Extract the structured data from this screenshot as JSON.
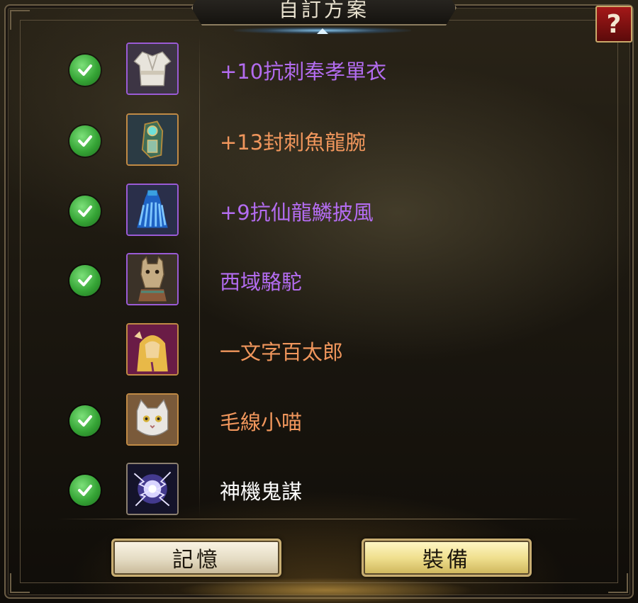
{
  "dialog": {
    "title": "自訂方案",
    "help_label": "?"
  },
  "items": [
    {
      "name": "+10抗刺奉孝單衣",
      "checked": true,
      "name_color": "#b36cf0",
      "icon": "white-robe-icon",
      "rarity": "purple"
    },
    {
      "name": "+13封刺魚龍腕",
      "checked": true,
      "name_color": "#f0965c",
      "icon": "jade-bracer-icon",
      "rarity": "gold"
    },
    {
      "name": "+9抗仙龍鱗披風",
      "checked": true,
      "name_color": "#b36cf0",
      "icon": "blue-feather-cloak-icon",
      "rarity": "purple"
    },
    {
      "name": "西域駱駝",
      "checked": true,
      "name_color": "#b36cf0",
      "icon": "camel-mount-icon",
      "rarity": "purple"
    },
    {
      "name": "一文字百太郎",
      "checked": false,
      "name_color": "#f0965c",
      "icon": "golden-hair-pet-icon",
      "rarity": "gold"
    },
    {
      "name": "毛線小喵",
      "checked": true,
      "name_color": "#f0965c",
      "icon": "white-cat-pet-icon",
      "rarity": "gold"
    },
    {
      "name": "神機鬼謀",
      "checked": true,
      "name_color": "#ffffff",
      "icon": "lightning-orb-skill-icon",
      "rarity": "none"
    }
  ],
  "buttons": {
    "memory_label": "記憶",
    "equip_label": "裝備"
  }
}
